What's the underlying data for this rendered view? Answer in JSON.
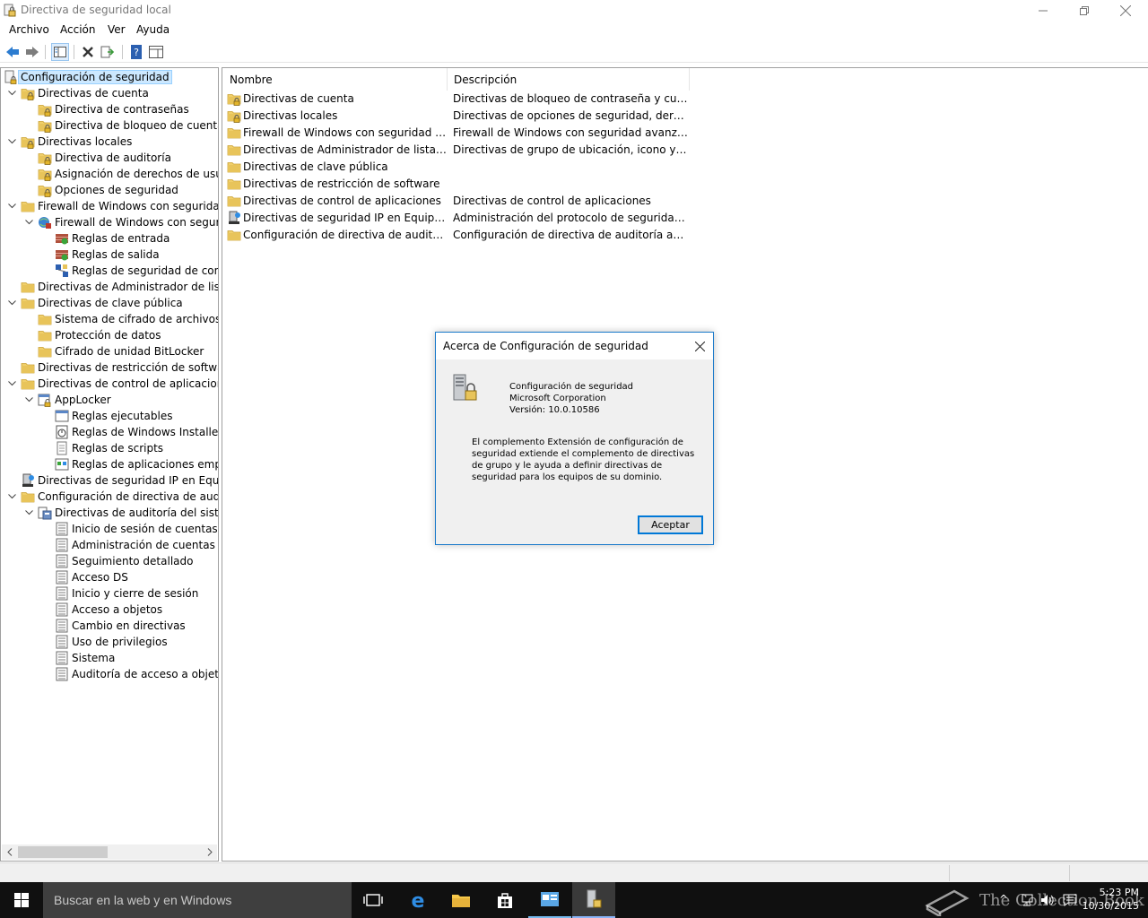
{
  "window": {
    "title": "Directiva de seguridad local"
  },
  "menu": [
    "Archivo",
    "Acción",
    "Ver",
    "Ayuda"
  ],
  "toolbar": {
    "icons": [
      "back-icon",
      "forward-icon",
      "show-tree-icon",
      "delete-icon",
      "export-icon",
      "help-icon",
      "properties-icon"
    ]
  },
  "tree": [
    {
      "label": "Configuración de seguridad",
      "indent": 0,
      "toggle": "",
      "icon": "security-icon",
      "selected": true
    },
    {
      "label": "Directivas de cuenta",
      "indent": 1,
      "toggle": "v",
      "icon": "lock-folder-icon"
    },
    {
      "label": "Directiva de contraseñas",
      "indent": 2,
      "toggle": "",
      "icon": "lock-folder-icon"
    },
    {
      "label": "Directiva de bloqueo de cuenta",
      "indent": 2,
      "toggle": "",
      "icon": "lock-folder-icon"
    },
    {
      "label": "Directivas locales",
      "indent": 1,
      "toggle": "v",
      "icon": "lock-folder-icon"
    },
    {
      "label": "Directiva de auditoría",
      "indent": 2,
      "toggle": "",
      "icon": "lock-folder-icon"
    },
    {
      "label": "Asignación de derechos de usuari",
      "indent": 2,
      "toggle": "",
      "icon": "lock-folder-icon"
    },
    {
      "label": "Opciones de seguridad",
      "indent": 2,
      "toggle": "",
      "icon": "lock-folder-icon"
    },
    {
      "label": "Firewall de Windows con seguridad av",
      "indent": 1,
      "toggle": "v",
      "icon": "folder-icon"
    },
    {
      "label": "Firewall de Windows con segurida",
      "indent": 2,
      "toggle": "v",
      "icon": "firewall-icon"
    },
    {
      "label": "Reglas de entrada",
      "indent": 3,
      "toggle": "",
      "icon": "rules-in-icon"
    },
    {
      "label": "Reglas de salida",
      "indent": 3,
      "toggle": "",
      "icon": "rules-out-icon"
    },
    {
      "label": "Reglas de seguridad de conexi",
      "indent": 3,
      "toggle": "",
      "icon": "connection-rules-icon"
    },
    {
      "label": "Directivas de Administrador de listas d",
      "indent": 1,
      "toggle": "",
      "icon": "folder-icon"
    },
    {
      "label": "Directivas de clave pública",
      "indent": 1,
      "toggle": "v",
      "icon": "folder-icon"
    },
    {
      "label": "Sistema de cifrado de archivos (EF",
      "indent": 2,
      "toggle": "",
      "icon": "folder-icon"
    },
    {
      "label": "Protección de datos",
      "indent": 2,
      "toggle": "",
      "icon": "folder-icon"
    },
    {
      "label": "Cifrado de unidad BitLocker",
      "indent": 2,
      "toggle": "",
      "icon": "folder-icon"
    },
    {
      "label": "Directivas de restricción de software",
      "indent": 1,
      "toggle": "",
      "icon": "folder-icon"
    },
    {
      "label": "Directivas de control de aplicaciones",
      "indent": 1,
      "toggle": "v",
      "icon": "folder-icon"
    },
    {
      "label": "AppLocker",
      "indent": 2,
      "toggle": "v",
      "icon": "applocker-icon"
    },
    {
      "label": "Reglas ejecutables",
      "indent": 3,
      "toggle": "",
      "icon": "exe-rules-icon"
    },
    {
      "label": "Reglas de Windows Installer",
      "indent": 3,
      "toggle": "",
      "icon": "installer-rules-icon"
    },
    {
      "label": "Reglas de scripts",
      "indent": 3,
      "toggle": "",
      "icon": "script-rules-icon"
    },
    {
      "label": "Reglas de aplicaciones empaq",
      "indent": 3,
      "toggle": "",
      "icon": "packaged-app-rules-icon"
    },
    {
      "label": "Directivas de seguridad IP en Equipo l",
      "indent": 1,
      "toggle": "",
      "icon": "ipsec-icon"
    },
    {
      "label": "Configuración de directiva de auditor",
      "indent": 1,
      "toggle": "v",
      "icon": "folder-icon"
    },
    {
      "label": "Directivas de auditoría del sistema",
      "indent": 2,
      "toggle": "v",
      "icon": "audit-policy-icon"
    },
    {
      "label": "Inicio de sesión de cuentas",
      "indent": 3,
      "toggle": "",
      "icon": "audit-item-icon"
    },
    {
      "label": "Administración de cuentas",
      "indent": 3,
      "toggle": "",
      "icon": "audit-item-icon"
    },
    {
      "label": "Seguimiento detallado",
      "indent": 3,
      "toggle": "",
      "icon": "audit-item-icon"
    },
    {
      "label": "Acceso DS",
      "indent": 3,
      "toggle": "",
      "icon": "audit-item-icon"
    },
    {
      "label": "Inicio y cierre de sesión",
      "indent": 3,
      "toggle": "",
      "icon": "audit-item-icon"
    },
    {
      "label": "Acceso a objetos",
      "indent": 3,
      "toggle": "",
      "icon": "audit-item-icon"
    },
    {
      "label": "Cambio en directivas",
      "indent": 3,
      "toggle": "",
      "icon": "audit-item-icon"
    },
    {
      "label": "Uso de privilegios",
      "indent": 3,
      "toggle": "",
      "icon": "audit-item-icon"
    },
    {
      "label": "Sistema",
      "indent": 3,
      "toggle": "",
      "icon": "audit-item-icon"
    },
    {
      "label": "Auditoría de acceso a objetos",
      "indent": 3,
      "toggle": "",
      "icon": "audit-item-icon"
    }
  ],
  "list": {
    "columns": [
      "Nombre",
      "Descripción"
    ],
    "rows": [
      {
        "name": "Directivas de cuenta",
        "desc": "Directivas de bloqueo de contraseña y cuenta",
        "icon": "lock-folder-icon"
      },
      {
        "name": "Directivas locales",
        "desc": "Directivas de opciones de seguridad, derechos ...",
        "icon": "lock-folder-icon"
      },
      {
        "name": "Firewall de Windows con seguridad avan...",
        "desc": "Firewall de Windows con seguridad avanzada",
        "icon": "folder-icon"
      },
      {
        "name": "Directivas de Administrador de listas de r...",
        "desc": "Directivas de grupo de ubicación, icono y nom...",
        "icon": "folder-icon"
      },
      {
        "name": "Directivas de clave pública",
        "desc": "",
        "icon": "folder-icon"
      },
      {
        "name": "Directivas de restricción de software",
        "desc": "",
        "icon": "folder-icon"
      },
      {
        "name": "Directivas de control de aplicaciones",
        "desc": "Directivas de control de aplicaciones",
        "icon": "folder-icon"
      },
      {
        "name": "Directivas de seguridad IP en Equipo local",
        "desc": "Administración del protocolo de seguridad de I...",
        "icon": "ipsec-icon"
      },
      {
        "name": "Configuración de directiva de auditoría a...",
        "desc": "Configuración de directiva de auditoría avanzada",
        "icon": "folder-icon"
      }
    ]
  },
  "dialog": {
    "title": "Acerca de Configuración de seguridad",
    "product": "Configuración de seguridad",
    "company": "Microsoft Corporation",
    "version": "Versión: 10.0.10586",
    "body": "El complemento Extensión de configuración de seguridad extiende el complemento de directivas de grupo y le ayuda a definir directivas de seguridad para los equipos de su dominio.",
    "ok_label": "Aceptar"
  },
  "taskbar": {
    "search_placeholder": "Buscar en la web y en Windows",
    "time": "5:23 PM",
    "date": "10/30/2015",
    "watermark": "The Collection Book"
  },
  "colors": {
    "folder": "#e8c45a",
    "accent": "#0078d7",
    "selection": "#cce8ff"
  }
}
